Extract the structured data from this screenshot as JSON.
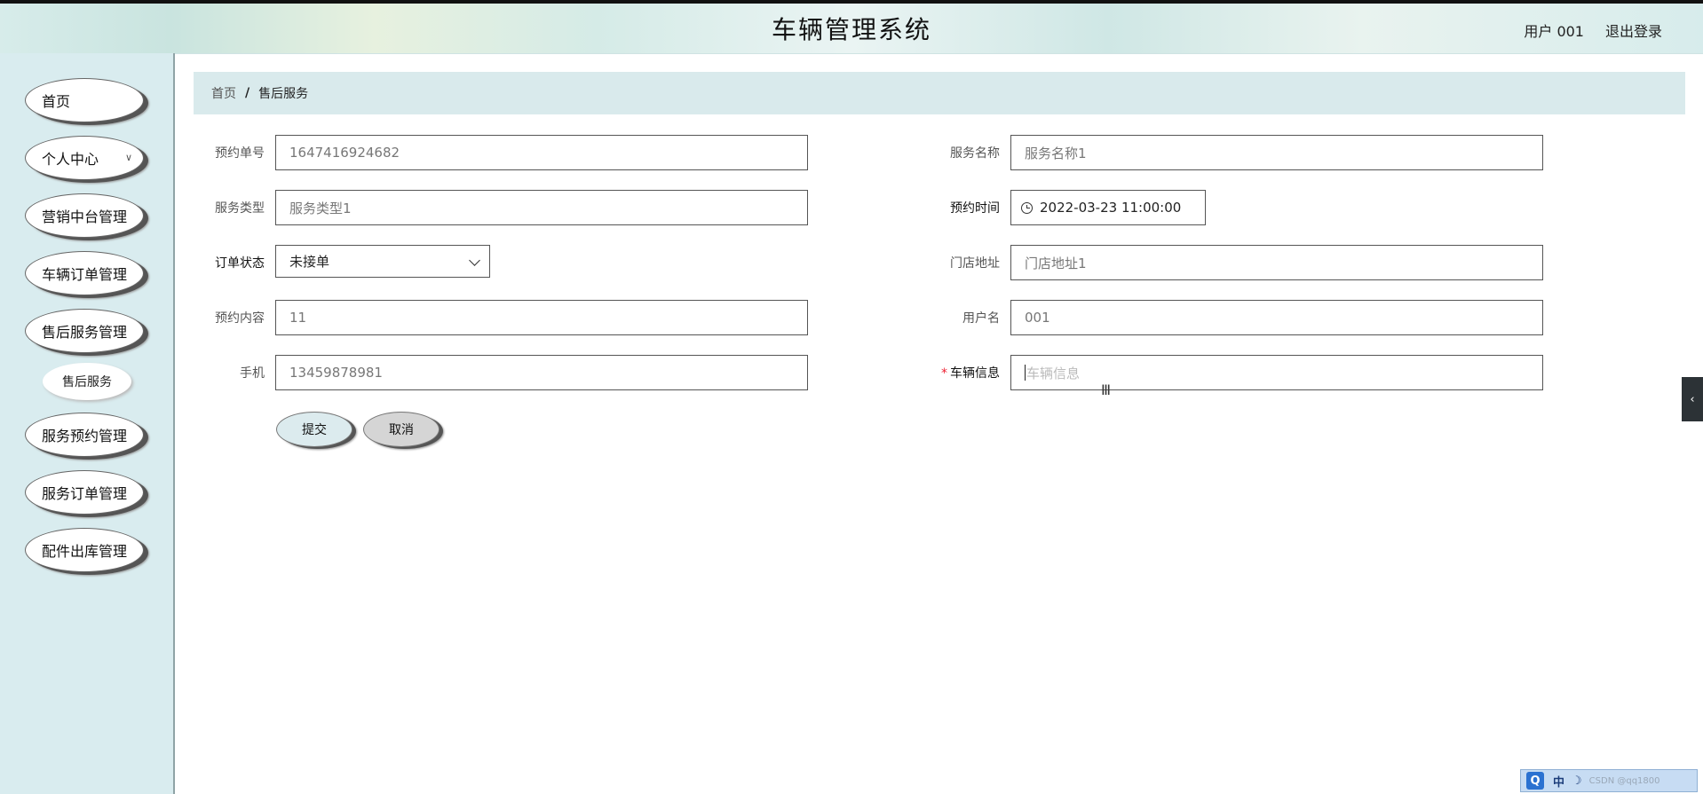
{
  "header": {
    "title": "车辆管理系统",
    "user": "用户 001",
    "logout": "退出登录"
  },
  "sidebar": {
    "items": [
      {
        "label": "首页"
      },
      {
        "label": "个人中心",
        "icon": "chevron-down-icon"
      },
      {
        "label": "营销中台管理"
      },
      {
        "label": "车辆订单管理"
      },
      {
        "label": "售后服务管理"
      },
      {
        "label": "服务预约管理"
      },
      {
        "label": "服务订单管理"
      },
      {
        "label": "配件出库管理"
      }
    ],
    "submenu": {
      "label": "售后服务"
    }
  },
  "breadcrumb": {
    "home": "首页",
    "separator": "/",
    "current": "售后服务"
  },
  "form": {
    "order_no": {
      "label": "预约单号",
      "value": "1647416924682"
    },
    "service_name": {
      "label": "服务名称",
      "value": "服务名称1"
    },
    "service_type": {
      "label": "服务类型",
      "value": "服务类型1"
    },
    "appointment_time": {
      "label": "预约时间",
      "value": "2022-03-23 11:00:00"
    },
    "order_status": {
      "label": "订单状态",
      "value": "未接单"
    },
    "store_address": {
      "label": "门店地址",
      "value": "门店地址1"
    },
    "content": {
      "label": "预约内容",
      "value": "11"
    },
    "username": {
      "label": "用户名",
      "value": "001"
    },
    "phone": {
      "label": "手机",
      "value": "13459878981"
    },
    "vehicle_info": {
      "label": "车辆信息",
      "required_mark": "*",
      "placeholder": "车辆信息"
    }
  },
  "buttons": {
    "submit": "提交",
    "cancel": "取消"
  },
  "edge_tab": {
    "icon": "chevron-left-icon",
    "glyph": "‹"
  },
  "tray": {
    "q": "Q",
    "lang": "中",
    "moon": "☽",
    "watermark": "CSDN @qq1800"
  },
  "colors": {
    "sidebar_bg": "#d9ecef",
    "breadcrumb_bg": "#d9eaec",
    "submit_bg": "#dcebee",
    "cancel_bg": "#d5d5d5",
    "required": "#ee2233"
  }
}
